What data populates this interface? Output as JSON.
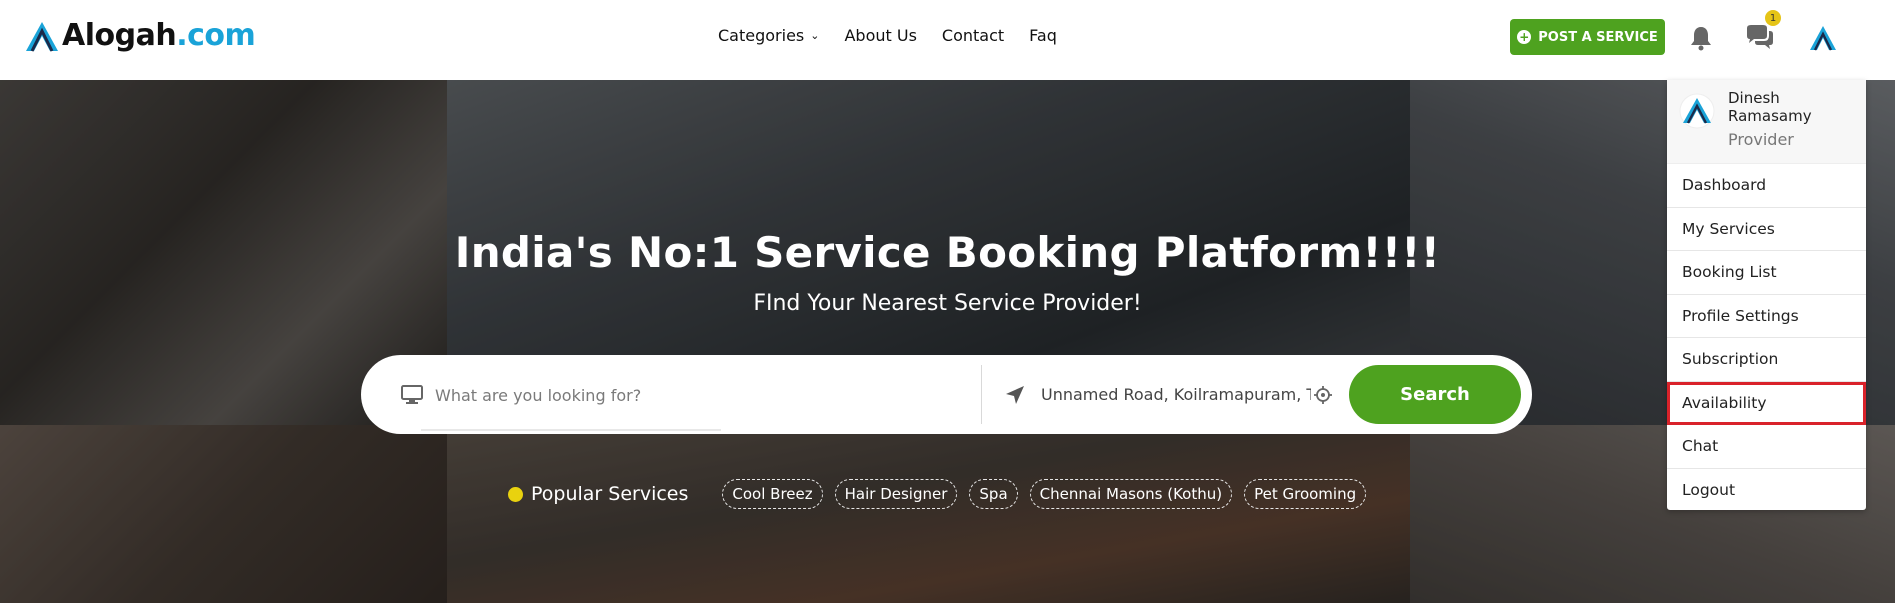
{
  "header": {
    "logo_main": "Alogah",
    "logo_domain": ".com",
    "nav": [
      {
        "label": "Categories",
        "has_dropdown": true
      },
      {
        "label": "About Us"
      },
      {
        "label": "Contact"
      },
      {
        "label": "Faq"
      }
    ],
    "post_service_label": "POST A SERVICE",
    "chat_badge_count": "1"
  },
  "hero": {
    "title": "India's No:1 Service Booking Platform!!!!",
    "subtitle": "FInd Your Nearest Service Provider!",
    "search": {
      "placeholder": "What are you looking for?",
      "location_value": "Unnamed Road, Koilramapuram, Ta",
      "button_label": "Search"
    },
    "popular": {
      "label": "Popular Services",
      "tags": [
        "Cool Breez",
        "Hair Designer",
        "Spa",
        "Chennai Masons (Kothu)",
        "Pet Grooming"
      ]
    }
  },
  "user_menu": {
    "name": "Dinesh Ramasamy",
    "role": "Provider",
    "items": [
      "Dashboard",
      "My Services",
      "Booking List",
      "Profile Settings",
      "Subscription",
      "Availability",
      "Chat",
      "Logout"
    ],
    "highlighted_item": "Availability"
  },
  "colors": {
    "brand_green": "#4ea21f",
    "logo_blue": "#1aa3d8",
    "badge_yellow": "#e5c417",
    "highlight_red": "#d9222a"
  }
}
